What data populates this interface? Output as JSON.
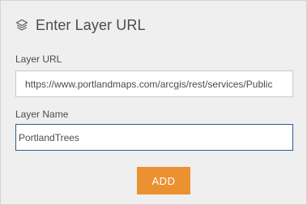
{
  "dialog": {
    "title": "Enter Layer URL",
    "icon": "layers-icon"
  },
  "layer_url": {
    "label": "Layer URL",
    "value": "https://www.portlandmaps.com/arcgis/rest/services/Public"
  },
  "layer_name": {
    "label": "Layer Name",
    "value": "PortlandTrees"
  },
  "actions": {
    "add_label": "ADD"
  },
  "colors": {
    "panel_background": "#efefef",
    "accent_button": "#ec9131",
    "focused_border": "#2e5b92",
    "text": "#4c4c4c"
  }
}
